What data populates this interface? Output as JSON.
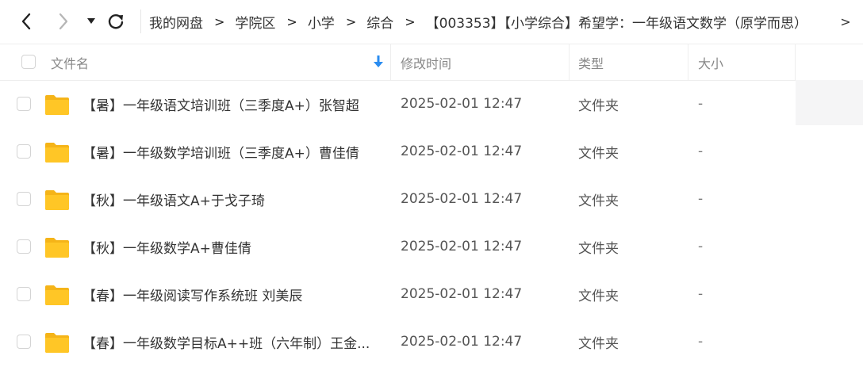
{
  "nav": {
    "back_icon": "chevron-left-icon",
    "forward_icon": "chevron-right-icon",
    "history_icon": "caret-down-icon",
    "refresh_icon": "refresh-icon"
  },
  "breadcrumb": {
    "items": [
      "我的网盘",
      "学院区",
      "小学",
      "综合",
      "【003353】【小学综合】希望学：一年级语文数学（原学而思）"
    ],
    "separator": ">",
    "more": ">"
  },
  "table": {
    "columns": {
      "name": "文件名",
      "modified": "修改时间",
      "type": "类型",
      "size": "大小"
    },
    "sort_icon": "sort-down-arrow-icon",
    "rows": [
      {
        "name": "【暑】一年级语文培训班（三季度A+）张智超",
        "modified": "2025-02-01 12:47",
        "type": "文件夹",
        "size": "-"
      },
      {
        "name": "【暑】一年级数学培训班（三季度A+）曹佳倩",
        "modified": "2025-02-01 12:47",
        "type": "文件夹",
        "size": "-"
      },
      {
        "name": "【秋】一年级语文A+于戈子琦",
        "modified": "2025-02-01 12:47",
        "type": "文件夹",
        "size": "-"
      },
      {
        "name": "【秋】一年级数学A+曹佳倩",
        "modified": "2025-02-01 12:47",
        "type": "文件夹",
        "size": "-"
      },
      {
        "name": "【春】一年级阅读写作系统班 刘美辰",
        "modified": "2025-02-01 12:47",
        "type": "文件夹",
        "size": "-"
      },
      {
        "name": "【春】一年级数学目标A++班（六年制）王金...",
        "modified": "2025-02-01 12:47",
        "type": "文件夹",
        "size": "-"
      }
    ]
  },
  "colors": {
    "folder": "#FFC626",
    "folder_back": "#F5B418",
    "accent": "#2A8CF0"
  }
}
